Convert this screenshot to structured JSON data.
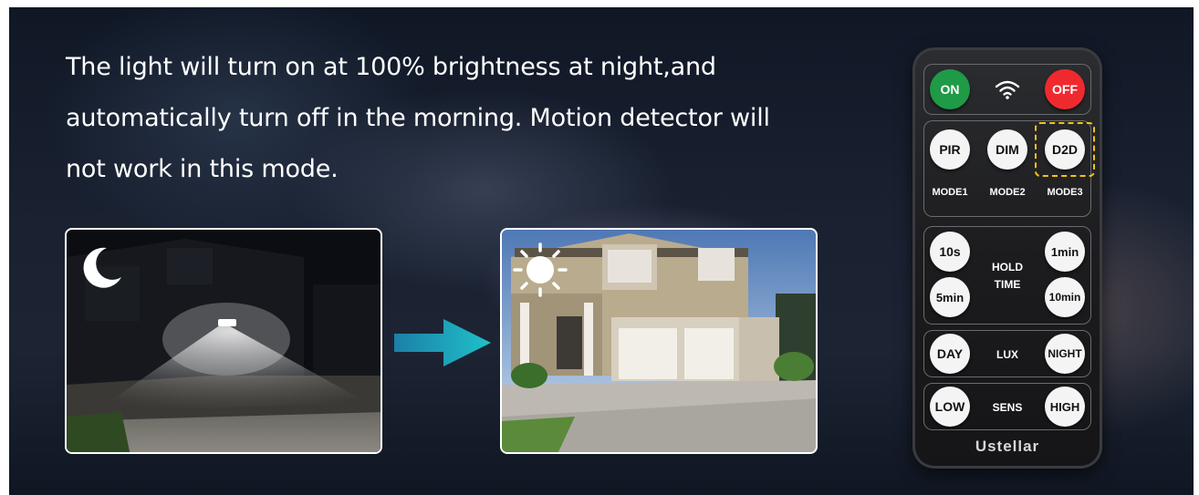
{
  "headline": {
    "line1": "The light will turn on at 100% brightness at night,and",
    "line2": "automatically turn off in the morning. Motion detector will",
    "line3": "not work in this mode."
  },
  "remote": {
    "on": "ON",
    "off": "OFF",
    "pir": "PIR",
    "dim": "DIM",
    "d2d": "D2D",
    "mode1": "MODE1",
    "mode2": "MODE2",
    "mode3": "MODE3",
    "t10s": "10s",
    "t1min": "1min",
    "t5min": "5min",
    "t10min": "10min",
    "hold": "HOLD",
    "time": "TIME",
    "day": "DAY",
    "lux": "LUX",
    "night": "NIGHT",
    "low": "LOW",
    "sens": "SENS",
    "high": "HIGH",
    "brand": "Ustellar"
  },
  "colors": {
    "on_button": "#1f9a47",
    "off_button": "#ef2a2f",
    "highlight": "#f2c318",
    "arrow": "#1fb1c4"
  },
  "icons": [
    "moon-icon",
    "sun-icon",
    "wifi-icon",
    "arrow-right-icon"
  ]
}
